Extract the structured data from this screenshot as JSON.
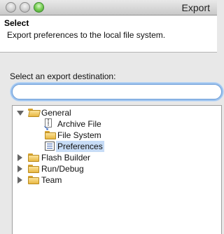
{
  "window": {
    "title": "Export"
  },
  "banner": {
    "title": "Select",
    "description": "Export preferences to the local file system."
  },
  "destination": {
    "label": "Select an export destination:",
    "filter_value": ""
  },
  "tree": {
    "items": [
      {
        "label": "General",
        "expanded": true,
        "icon": "folder-open-icon"
      },
      {
        "label": "Archive File",
        "icon": "archive-file-icon"
      },
      {
        "label": "File System",
        "icon": "folder-icon"
      },
      {
        "label": "Preferences",
        "icon": "preferences-icon",
        "selected": true
      },
      {
        "label": "Flash Builder",
        "expanded": false,
        "icon": "folder-icon"
      },
      {
        "label": "Run/Debug",
        "expanded": false,
        "icon": "folder-icon"
      },
      {
        "label": "Team",
        "expanded": false,
        "icon": "folder-icon"
      }
    ]
  },
  "colors": {
    "selection": "#c7dcf6",
    "focus_ring": "#9cc2ee",
    "zoom_button": "#5cbf3a"
  }
}
